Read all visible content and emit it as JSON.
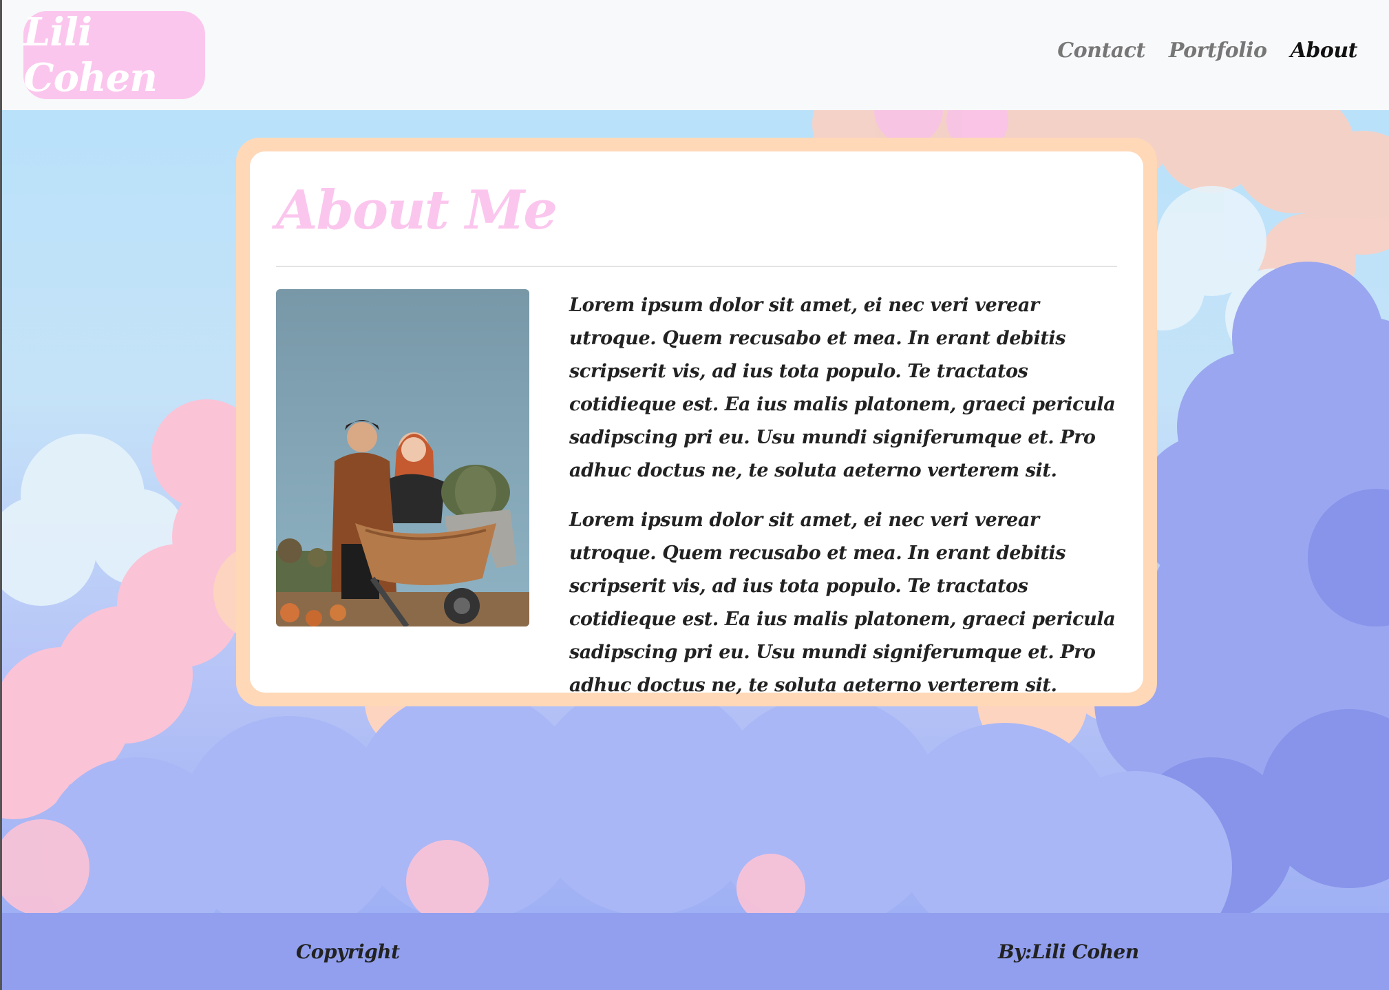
{
  "header": {
    "brand": "Lili Cohen",
    "nav": [
      {
        "label": "Contact",
        "active": false
      },
      {
        "label": "Portfolio",
        "active": false
      },
      {
        "label": "About",
        "active": true
      }
    ]
  },
  "main": {
    "title": "About Me",
    "paragraphs": [
      "Lorem ipsum dolor sit amet, ei nec veri verear utroque. Quem recusabo et mea. In erant debitis scripserit vis, ad ius tota populo. Te tractatos cotidieque est. Ea ius malis platonem, graeci pericula sadipscing pri eu. Usu mundi signiferumque et. Pro adhuc doctus ne, te soluta aeterno verterem sit.",
      "Lorem ipsum dolor sit amet, ei nec veri verear utroque. Quem recusabo et mea. In erant debitis scripserit vis, ad ius tota populo. Te tractatos cotidieque est. Ea ius malis platonem, graeci pericula sadipscing pri eu. Usu mundi signiferumque et. Pro adhuc doctus ne, te soluta aeterno verterem sit."
    ]
  },
  "footer": {
    "left": "Copyright",
    "right": "By:Lili Cohen"
  },
  "colors": {
    "brand_pink": "#fbc6ee",
    "card_border": "#ffd8b8",
    "footer_bg": "#919fee",
    "header_bg": "#f8f9fa"
  }
}
